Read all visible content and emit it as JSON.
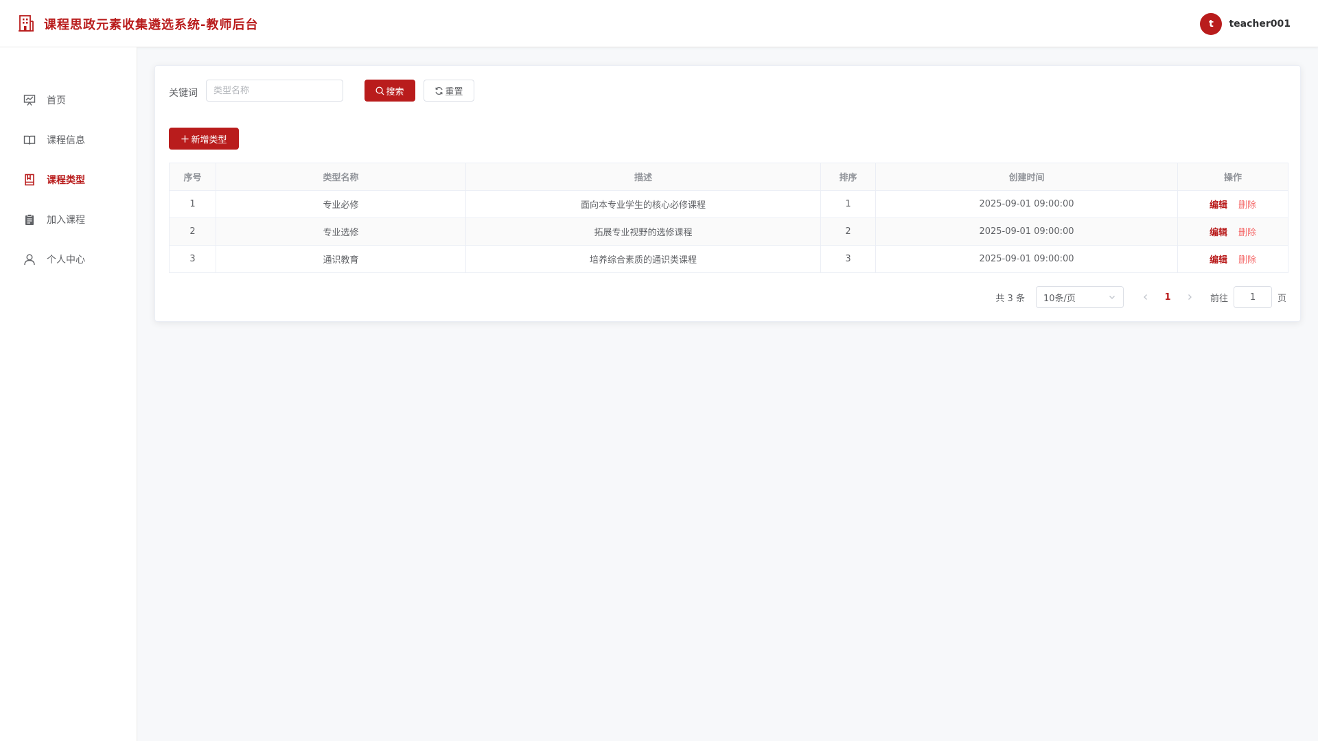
{
  "header": {
    "title": "课程思政元素收集遴选系统-教师后台",
    "avatar_letter": "t",
    "username": "teacher001"
  },
  "sidebar": {
    "items": [
      {
        "label": "首页",
        "icon": "presentation-icon",
        "active": false
      },
      {
        "label": "课程信息",
        "icon": "book-open-icon",
        "active": false
      },
      {
        "label": "课程类型",
        "icon": "notebook-icon",
        "active": true
      },
      {
        "label": "加入课程",
        "icon": "clipboard-icon",
        "active": false
      },
      {
        "label": "个人中心",
        "icon": "user-icon",
        "active": false
      }
    ]
  },
  "search": {
    "label": "关键词",
    "placeholder": "类型名称",
    "value": "",
    "search_label": "搜索",
    "reset_label": "重置"
  },
  "toolbar": {
    "add_label": "新增类型"
  },
  "table": {
    "columns": [
      "序号",
      "类型名称",
      "描述",
      "排序",
      "创建时间",
      "操作"
    ],
    "rows": [
      {
        "index": "1",
        "name": "专业必修",
        "desc": "面向本专业学生的核心必修课程",
        "sort": "1",
        "created": "2025-09-01 09:00:00"
      },
      {
        "index": "2",
        "name": "专业选修",
        "desc": "拓展专业视野的选修课程",
        "sort": "2",
        "created": "2025-09-01 09:00:00"
      },
      {
        "index": "3",
        "name": "通识教育",
        "desc": "培养综合素质的通识类课程",
        "sort": "3",
        "created": "2025-09-01 09:00:00"
      }
    ],
    "edit_label": "编辑",
    "delete_label": "删除"
  },
  "pagination": {
    "total": "共 3 条",
    "page_size": "10条/页",
    "current_page": "1",
    "goto_label": "前往",
    "goto_value": "1",
    "page_suffix": "页"
  },
  "colors": {
    "primary": "#b91c1c",
    "danger": "#f56c6c",
    "background": "#f7f8fa"
  }
}
